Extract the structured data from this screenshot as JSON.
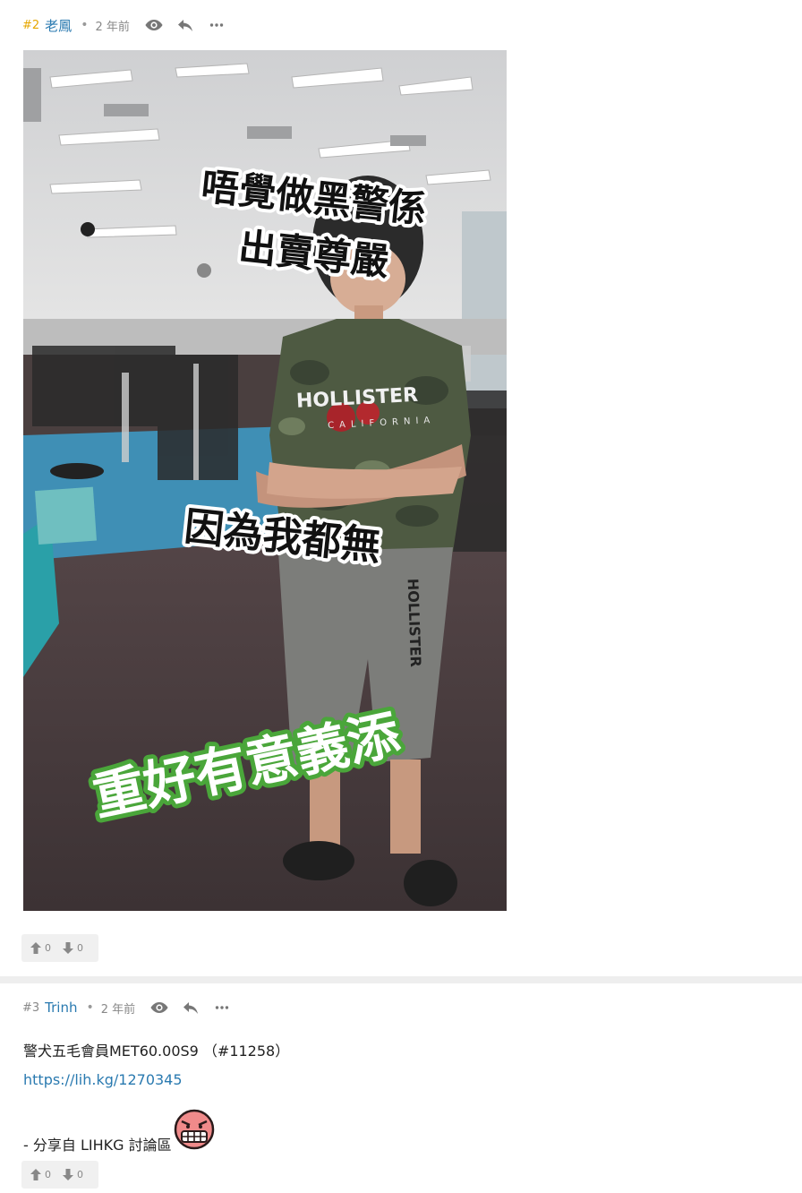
{
  "posts": [
    {
      "floor": "#2",
      "username": "老鳳",
      "separator": "•",
      "time": "2 年前",
      "image": {
        "texts": [
          "唔覺做黑警係",
          "出賣尊嚴",
          "因為我都無",
          "重好有意義添"
        ],
        "shirt_text": "HOLLISTER",
        "shirt_sub": "CALIFORNIA",
        "shorts_text": "HOLLISTER"
      },
      "upvotes": "0",
      "downvotes": "0"
    },
    {
      "floor": "#3",
      "username": "Trinh",
      "separator": "•",
      "time": "2 年前",
      "line1": "警犬五毛會員MET60.00S9 （#11258）",
      "link": "https://lih.kg/1270345",
      "share": "- 分享自 LIHKG 討論區",
      "upvotes": "0",
      "downvotes": "0"
    }
  ],
  "icons": {
    "view": "eye-icon",
    "reply": "reply-icon",
    "more": "more-icon",
    "up": "thumb-up-icon",
    "down": "thumb-down-icon"
  },
  "colors": {
    "username": "#2a7ab0",
    "floor_highlight": "#e6a700",
    "caption_green": "#4aa63a"
  }
}
